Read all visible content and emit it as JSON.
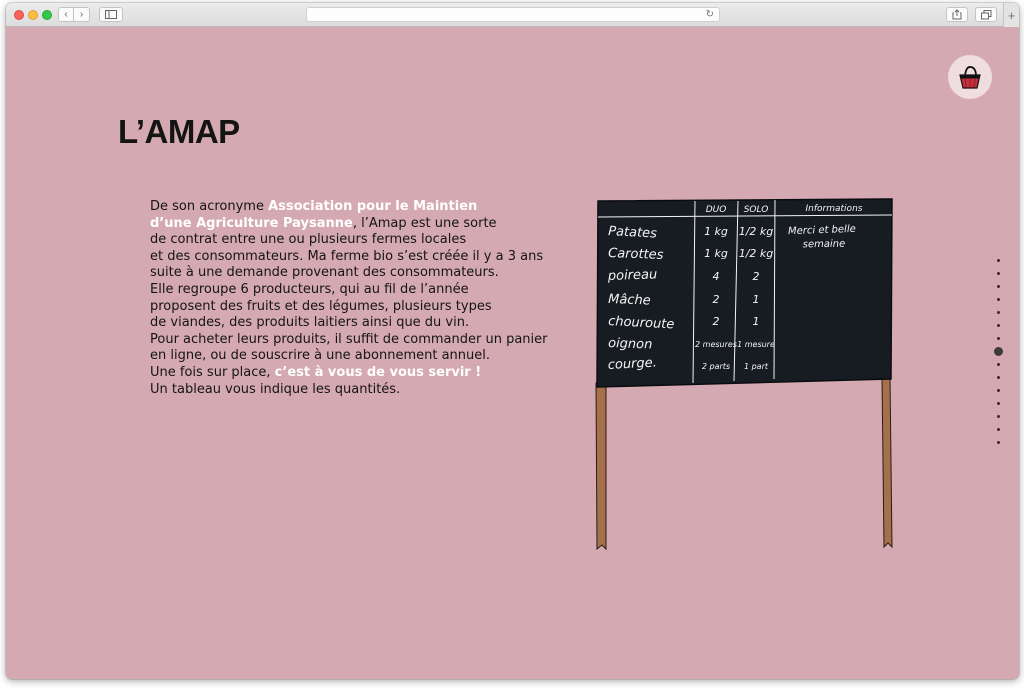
{
  "browser": {
    "address": "",
    "back_glyph": "‹",
    "forward_glyph": "›",
    "newtab_glyph": "+",
    "reload_glyph": "↻",
    "share_glyph": "⇪",
    "tabs_glyph": "⧉",
    "colors": {
      "red": "#fc605c",
      "yellow": "#fdbc40",
      "green": "#34c84a"
    }
  },
  "page": {
    "background": "#d5a9b2",
    "title": "L’AMAP",
    "intro": {
      "l1_a": "De son acronyme ",
      "l1_b": "Association pour le Maintien",
      "l2_a": "d’une Agriculture Paysanne",
      "l2_b": ", l’Amap est une sorte",
      "l3": "de contrat entre une ou plusieurs fermes locales",
      "l4": "et des consommateurs. Ma ferme bio s’est créée il y a 3 ans",
      "l5": "suite à une demande provenant des consommateurs.",
      "l6": "Elle regroupe 6 producteurs, qui au fil de l’année",
      "l7": "proposent des fruits et des légumes, plusieurs types",
      "l8": "de viandes, des produits laitiers ainsi que du vin.",
      "l9": "Pour acheter leurs produits, il suffit de commander un panier",
      "l10": "en ligne, ou de souscrire à une abonnement annuel.",
      "l11_a": "Une fois sur place, ",
      "l11_b": "c’est à vous de vous servir !",
      "l12": "Un tableau vous indique les quantités."
    },
    "highlight_color": "#ffffff",
    "basket_icon": "basket-icon"
  },
  "board": {
    "headers": [
      "DUO",
      "SOLO",
      "Informations"
    ],
    "rows": [
      {
        "product": "Patates",
        "duo": "1 kg",
        "solo": "1/2 kg"
      },
      {
        "product": "Carottes",
        "duo": "1 kg",
        "solo": "1/2 kg"
      },
      {
        "product": "poireau",
        "duo": "4",
        "solo": "2"
      },
      {
        "product": "Mâche",
        "duo": "2",
        "solo": "1"
      },
      {
        "product": "chouroute",
        "duo": "2",
        "solo": "1"
      },
      {
        "product": "oignon",
        "duo": "2 mesures",
        "solo": "1 mesure"
      },
      {
        "product": "courge.",
        "duo": "2 parts",
        "solo": "1 part"
      }
    ],
    "info": [
      "Merci et belle",
      "semaine"
    ],
    "colors": {
      "board": "#161c21",
      "legs": "#a5714c",
      "chalk": "#f4f4f4"
    }
  },
  "nav": {
    "dot_count": 15,
    "active_index": 7
  }
}
